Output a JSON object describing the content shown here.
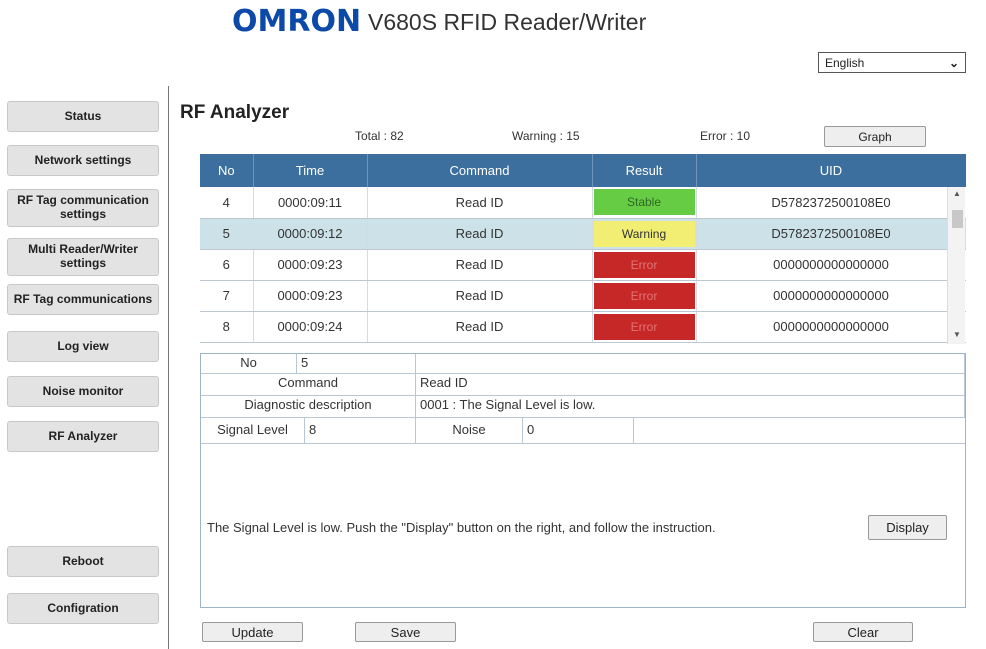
{
  "header": {
    "brand": "OMRON",
    "title": "V680S RFID Reader/Writer",
    "language": "English"
  },
  "sidebar": {
    "items": [
      {
        "label": "Status"
      },
      {
        "label": "Network settings"
      },
      {
        "label": "RF Tag communication settings"
      },
      {
        "label": "Multi Reader/Writer settings"
      },
      {
        "label": "RF Tag communications"
      },
      {
        "label": "Log view"
      },
      {
        "label": "Noise monitor"
      },
      {
        "label": "RF Analyzer"
      },
      {
        "label": "Reboot"
      },
      {
        "label": "Configration"
      }
    ]
  },
  "page": {
    "title": "RF Analyzer",
    "total": "Total : 82",
    "warning": "Warning : 15",
    "error": "Error : 10",
    "graph_button": "Graph"
  },
  "table": {
    "columns": [
      "No",
      "Time",
      "Command",
      "Result",
      "UID"
    ],
    "rows": [
      {
        "no": "4",
        "time": "0000:09:11",
        "command": "Read ID",
        "result": "Stable",
        "uid": "D5782372500108E0"
      },
      {
        "no": "5",
        "time": "0000:09:12",
        "command": "Read ID",
        "result": "Warning",
        "uid": "D5782372500108E0"
      },
      {
        "no": "6",
        "time": "0000:09:23",
        "command": "Read ID",
        "result": "Error",
        "uid": "0000000000000000"
      },
      {
        "no": "7",
        "time": "0000:09:23",
        "command": "Read ID",
        "result": "Error",
        "uid": "0000000000000000"
      },
      {
        "no": "8",
        "time": "0000:09:24",
        "command": "Read ID",
        "result": "Error",
        "uid": "0000000000000000"
      }
    ]
  },
  "detail": {
    "no_label": "No",
    "no_value": "5",
    "command_label": "Command",
    "command_value": "Read ID",
    "diag_label": "Diagnostic description",
    "diag_value": "0001 : The Signal Level is low.",
    "signal_label": "Signal Level",
    "signal_value": "8",
    "noise_label": "Noise",
    "noise_value": "0",
    "advice": "The Signal Level is low. Push the \"Display\" button on the right, and follow the instruction.",
    "display_button": "Display"
  },
  "footer": {
    "update": "Update",
    "save": "Save",
    "clear": "Clear"
  },
  "colors": {
    "brand": "#0b4aa8",
    "table_header": "#3d6f9e",
    "selected_row": "#cde1e8",
    "stable": "#66cc44",
    "warning": "#f2ee73",
    "error": "#c62828"
  }
}
